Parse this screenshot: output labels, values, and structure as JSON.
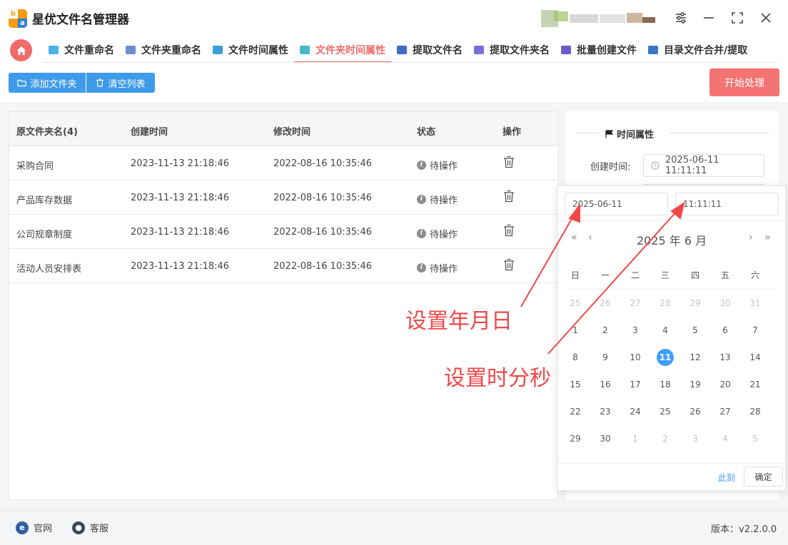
{
  "app": {
    "title": "星优文件名管理器"
  },
  "tabs": [
    {
      "label": "文件重命名",
      "color": "#4bb4e6",
      "active": false
    },
    {
      "label": "文件夹重命名",
      "color": "#6a8fcf",
      "active": false
    },
    {
      "label": "文件时间属性",
      "color": "#3a9fd8",
      "active": false
    },
    {
      "label": "文件夹时间属性",
      "color": "#49b7c7",
      "active": true
    },
    {
      "label": "提取文件名",
      "color": "#3f6cc6",
      "active": false
    },
    {
      "label": "提取文件夹名",
      "color": "#7b6fd8",
      "active": false
    },
    {
      "label": "批量创建文件",
      "color": "#6d5bd0",
      "active": false
    },
    {
      "label": "目录文件合并/提取",
      "color": "#3a78c8",
      "active": false
    }
  ],
  "toolbar": {
    "add_folder": "添加文件夹",
    "clear_list": "清空列表",
    "start": "开始处理"
  },
  "table": {
    "headers": [
      "原文件夹名(4)",
      "创建时间",
      "修改时间",
      "状态",
      "操作"
    ],
    "rows": [
      {
        "name": "采购合同",
        "created": "2023-11-13 21:18:46",
        "modified": "2022-08-16 10:35:46",
        "status": "待操作"
      },
      {
        "name": "产品库存数据",
        "created": "2023-11-13 21:18:46",
        "modified": "2022-08-16 10:35:46",
        "status": "待操作"
      },
      {
        "name": "公司规章制度",
        "created": "2023-11-13 21:18:46",
        "modified": "2022-08-16 10:35:46",
        "status": "待操作"
      },
      {
        "name": "活动人员安排表",
        "created": "2023-11-13 21:18:46",
        "modified": "2022-08-16 10:35:46",
        "status": "待操作"
      }
    ]
  },
  "side": {
    "title": "时间属性",
    "created_label": "创建时间:",
    "created_value": "2025-06-11 11:11:11"
  },
  "picker": {
    "date_value": "2025-06-11",
    "time_value": "11:11:11",
    "header": "2025 年  6 月",
    "weekdays": [
      "日",
      "一",
      "二",
      "三",
      "四",
      "五",
      "六"
    ],
    "weeks": [
      [
        "25",
        "26",
        "27",
        "28",
        "29",
        "30",
        "31"
      ],
      [
        "1",
        "2",
        "3",
        "4",
        "5",
        "6",
        "7"
      ],
      [
        "8",
        "9",
        "10",
        "11",
        "12",
        "13",
        "14"
      ],
      [
        "15",
        "16",
        "17",
        "18",
        "19",
        "20",
        "21"
      ],
      [
        "22",
        "23",
        "24",
        "25",
        "26",
        "27",
        "28"
      ],
      [
        "29",
        "30",
        "1",
        "2",
        "3",
        "4",
        "5"
      ]
    ],
    "selected_day": "11",
    "now": "此刻",
    "ok": "确定"
  },
  "annotations": {
    "date": "设置年月日",
    "time": "设置时分秒"
  },
  "footer": {
    "website": "官网",
    "support": "客服",
    "version": "版本：v2.2.0.0"
  }
}
